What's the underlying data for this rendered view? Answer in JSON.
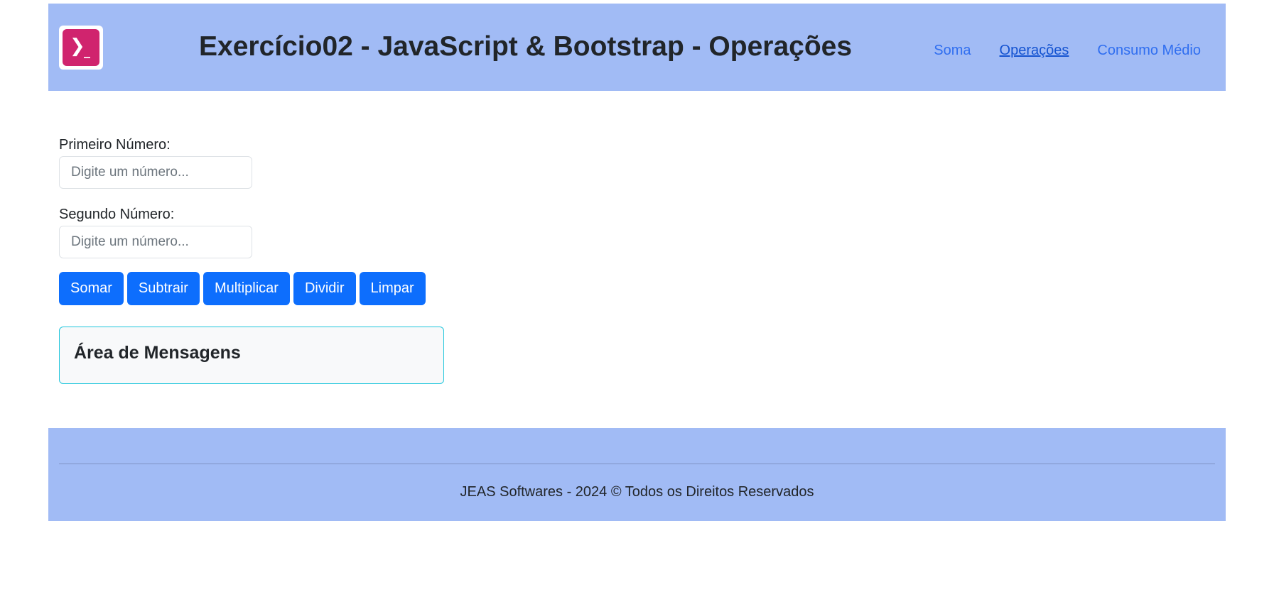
{
  "header": {
    "title": "Exercício02 - JavaScript & Bootstrap - Operações",
    "logo": {
      "icon": "terminal-prompt-icon",
      "chevron": "❯",
      "underscore": "_",
      "color": "#d0246e"
    },
    "nav": [
      {
        "label": "Soma",
        "active": false
      },
      {
        "label": "Operações",
        "active": true
      },
      {
        "label": "Consumo Médio",
        "active": false
      }
    ],
    "background": "#a1bbf5"
  },
  "form": {
    "first": {
      "label": "Primeiro Número:",
      "value": "",
      "placeholder": "Digite um número..."
    },
    "second": {
      "label": "Segundo Número:",
      "value": "",
      "placeholder": "Digite um número..."
    }
  },
  "buttons": {
    "add": "Somar",
    "subtract": "Subtrair",
    "multiply": "Multiplicar",
    "divide": "Dividir",
    "clear": "Limpar",
    "color": "#0d6efd"
  },
  "messages": {
    "title": "Área de Mensagens",
    "border_color": "#1fc6dc"
  },
  "footer": {
    "text": "JEAS Softwares - 2024 © Todos os Direitos Reservados"
  }
}
